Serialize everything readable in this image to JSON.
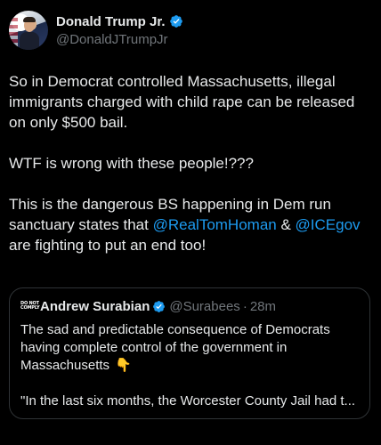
{
  "author": {
    "display_name": "Donald Trump Jr.",
    "handle": "@DonaldJTrumpJr",
    "verified_color": "#1d9bf0"
  },
  "tweet": {
    "paragraph_1": "So in Democrat controlled Massachusetts, illegal immigrants charged with child rape can be released on only $500 bail.",
    "paragraph_2": "WTF is wrong with these people!???",
    "paragraph_3_start": "This is the dangerous BS happening in Dem run sanctuary states that ",
    "mention_1": "@RealTomHoman",
    "connector": " & ",
    "mention_2": "@ICEgov",
    "paragraph_3_end": " are fighting to put an end too!"
  },
  "quoted": {
    "logo_line_1": "DO NOT",
    "logo_line_2": "COMPLY",
    "display_name": "Andrew Surabian",
    "handle": "@Surabees",
    "separator": "·",
    "time": "28m",
    "text_1": "The sad and predictable consequence of Democrats having complete control of the government in Massachusetts",
    "emoji": "👇",
    "text_2": "\"In the last six months, the Worcester County Jail had t..."
  },
  "colors": {
    "background": "#000000",
    "text": "#e7e9ea",
    "secondary": "#71767b",
    "link": "#1d9bf0",
    "border": "#2f3336"
  }
}
